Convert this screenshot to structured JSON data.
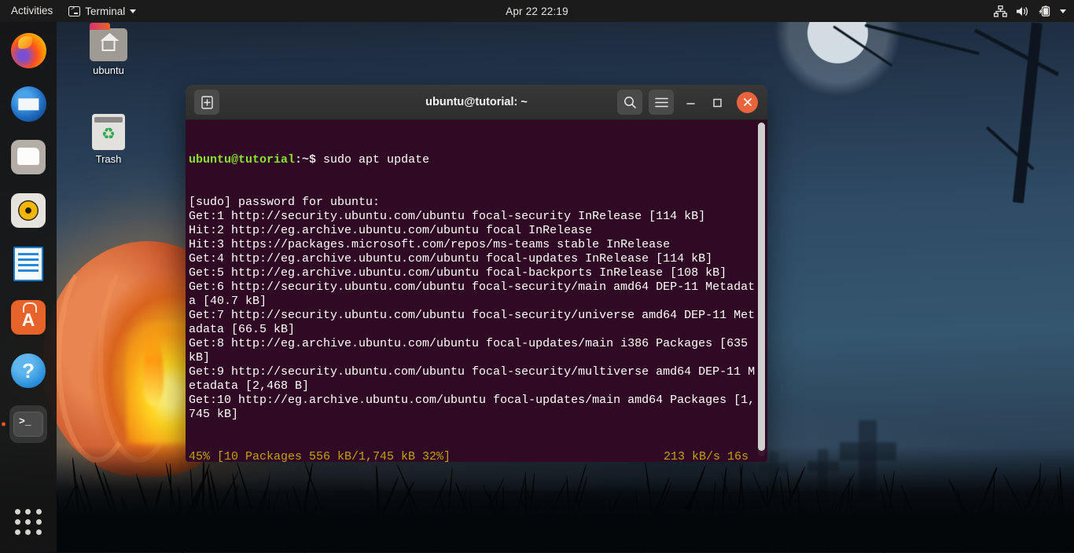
{
  "topbar": {
    "activities": "Activities",
    "app_name": "Terminal",
    "clock": "Apr 22  22:19",
    "icons": {
      "app": "terminal-icon",
      "caret": "chevron-down-icon",
      "network": "network-icon",
      "volume": "volume-icon",
      "battery": "battery-charging-icon",
      "tray_caret": "chevron-down-icon"
    }
  },
  "dock": {
    "items": [
      {
        "name": "firefox",
        "label": "Firefox",
        "active": false
      },
      {
        "name": "thunderbird",
        "label": "Thunderbird Mail",
        "active": false
      },
      {
        "name": "files",
        "label": "Files",
        "active": false
      },
      {
        "name": "rhythmbox",
        "label": "Rhythmbox",
        "active": false
      },
      {
        "name": "libreoffice-writer",
        "label": "LibreOffice Writer",
        "active": false
      },
      {
        "name": "ubuntu-software",
        "label": "Ubuntu Software",
        "active": false
      },
      {
        "name": "help",
        "label": "Help",
        "active": false
      },
      {
        "name": "terminal",
        "label": "Terminal",
        "active": true
      }
    ],
    "apps_grid_label": "Show Applications"
  },
  "desktop_icons": [
    {
      "name": "home-folder",
      "label": "ubuntu"
    },
    {
      "name": "trash",
      "label": "Trash"
    }
  ],
  "window": {
    "title": "ubuntu@tutorial: ~",
    "buttons": {
      "new_tab": "new-tab-icon",
      "search": "search-icon",
      "menu": "hamburger-menu-icon",
      "minimize": "–",
      "maximize": "□",
      "close": "×"
    }
  },
  "terminal": {
    "prompt_user": "ubuntu@tutorial",
    "prompt_path": ":~$",
    "command": " sudo apt update",
    "lines": [
      "[sudo] password for ubuntu:",
      "Get:1 http://security.ubuntu.com/ubuntu focal-security InRelease [114 kB]",
      "Hit:2 http://eg.archive.ubuntu.com/ubuntu focal InRelease",
      "Hit:3 https://packages.microsoft.com/repos/ms-teams stable InRelease",
      "Get:4 http://eg.archive.ubuntu.com/ubuntu focal-updates InRelease [114 kB]",
      "Get:5 http://eg.archive.ubuntu.com/ubuntu focal-backports InRelease [108 kB]",
      "Get:6 http://security.ubuntu.com/ubuntu focal-security/main amd64 DEP-11 Metadat",
      "a [40.7 kB]",
      "Get:7 http://security.ubuntu.com/ubuntu focal-security/universe amd64 DEP-11 Met",
      "adata [66.5 kB]",
      "Get:8 http://eg.archive.ubuntu.com/ubuntu focal-updates/main i386 Packages [635",
      "kB]",
      "Get:9 http://security.ubuntu.com/ubuntu focal-security/multiverse amd64 DEP-11 M",
      "etadata [2,468 B]",
      "Get:10 http://eg.archive.ubuntu.com/ubuntu focal-updates/main amd64 Packages [1,",
      "745 kB]"
    ],
    "progress_left": "45% [10 Packages 556 kB/1,745 kB 32%]",
    "progress_right": "213 kB/s 16s"
  },
  "colors": {
    "terminal_bg": "#300a24",
    "prompt_green": "#8ae234",
    "progress_amber": "#c4a000",
    "close_button": "#e8643c",
    "ubuntu_orange": "#e95420"
  }
}
